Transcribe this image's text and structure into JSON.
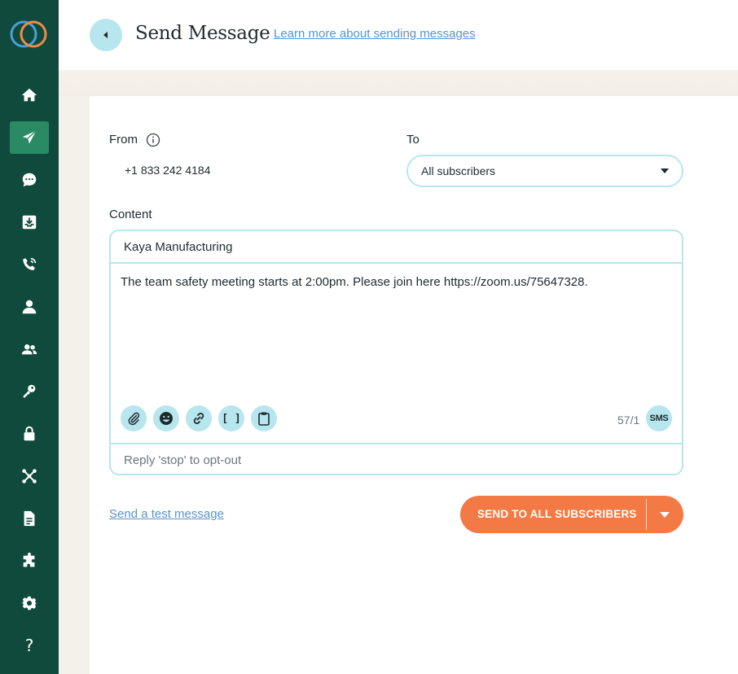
{
  "colors": {
    "sidebar": "#0f4a3c",
    "sidebar_active": "#2a8a63",
    "accent_light": "#b7e6ee",
    "primary_button": "#f47a45",
    "link": "#5a93c8"
  },
  "sidebar": {
    "items": [
      {
        "icon": "home-icon",
        "active": false
      },
      {
        "icon": "send-icon",
        "active": true
      },
      {
        "icon": "chat-icon",
        "active": false
      },
      {
        "icon": "inbox-icon",
        "active": false
      },
      {
        "icon": "phone-icon",
        "active": false
      },
      {
        "icon": "user-icon",
        "active": false
      },
      {
        "icon": "users-icon",
        "active": false
      },
      {
        "icon": "key-icon",
        "active": false
      },
      {
        "icon": "lock-icon",
        "active": false
      },
      {
        "icon": "integrations-icon",
        "active": false
      },
      {
        "icon": "document-icon",
        "active": false
      },
      {
        "icon": "puzzle-icon",
        "active": false
      },
      {
        "icon": "gear-icon",
        "active": false
      },
      {
        "icon": "help-icon",
        "active": false,
        "label": "?"
      }
    ]
  },
  "header": {
    "title": "Send Message",
    "learn_link": "Learn more about sending messages"
  },
  "form": {
    "from_label": "From",
    "from_value": "+1 833 242 4184",
    "to_label": "To",
    "to_value": "All subscribers",
    "content_label": "Content"
  },
  "compose": {
    "sender_name": "Kaya Manufacturing",
    "body": "The team safety meeting starts at 2:00pm. Please join here https://zoom.us/75647328.",
    "tools": [
      "attachment-icon",
      "emoji-icon",
      "link-icon",
      "merge-field-icon",
      "template-icon"
    ],
    "merge_field_glyph": "[ ]",
    "char_count": "57/1",
    "channel_badge": "SMS",
    "footer": "Reply 'stop' to opt-out"
  },
  "actions": {
    "test_link": "Send a test message",
    "send_label": "SEND TO ALL SUBSCRIBERS"
  }
}
